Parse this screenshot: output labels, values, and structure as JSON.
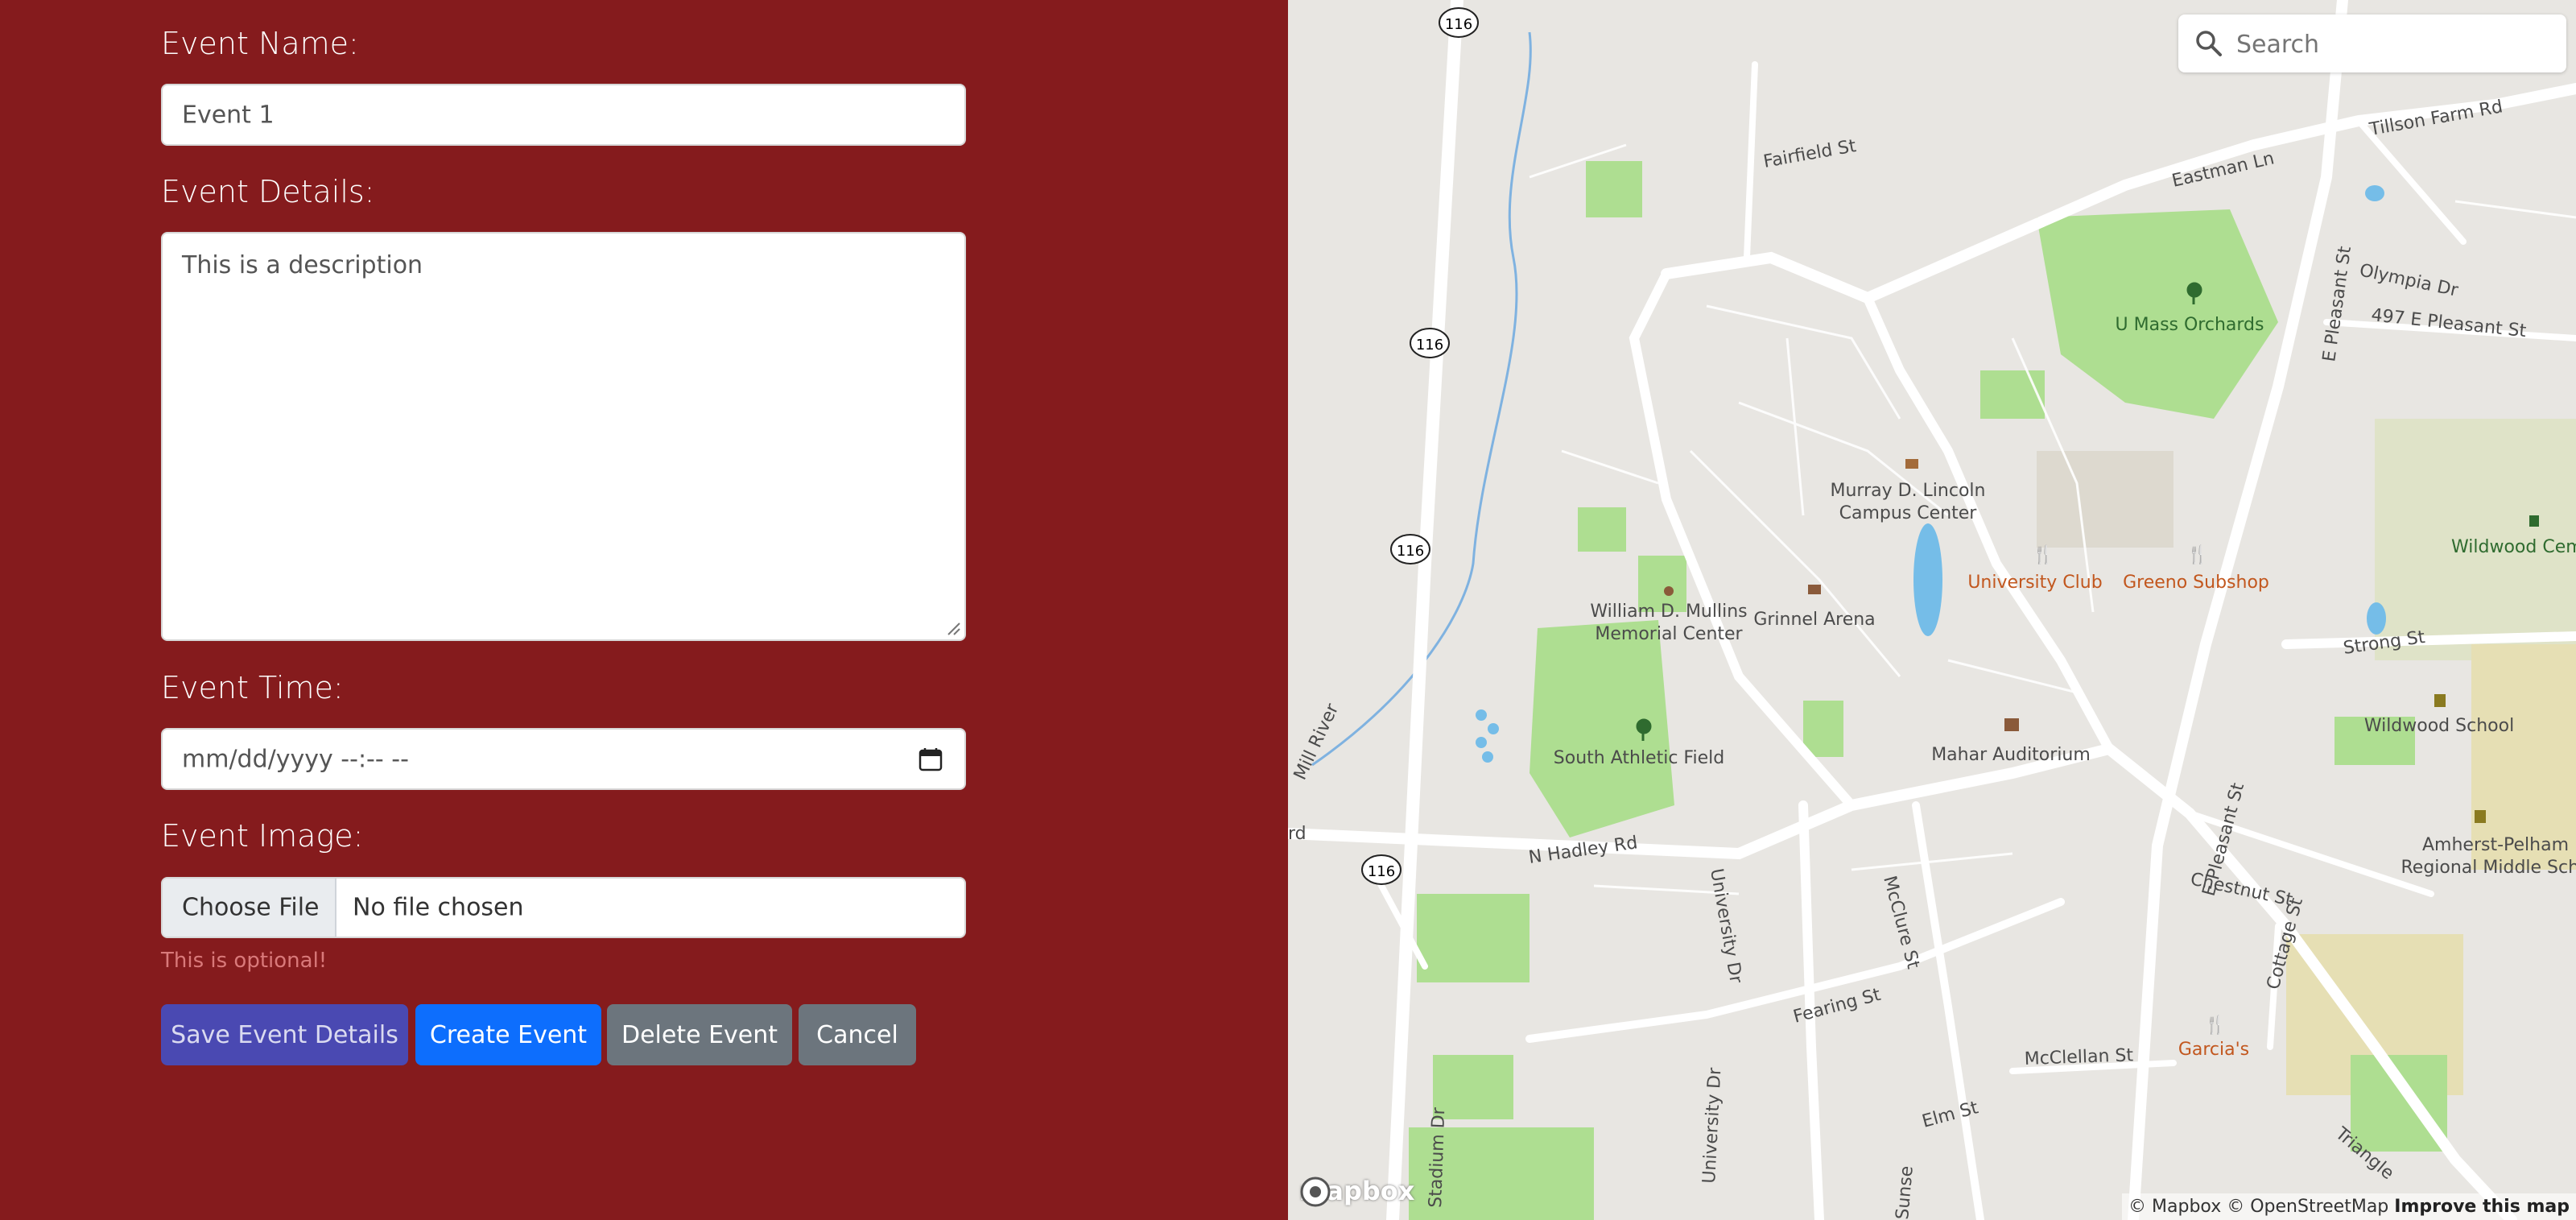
{
  "form": {
    "name_label": "Event Name:",
    "name_value": "Event 1",
    "details_label": "Event Details:",
    "details_value": "This is a description",
    "time_label": "Event Time:",
    "time_placeholder": "mm/dd/yyyy --:-- --",
    "image_label": "Event Image:",
    "choose_file_label": "Choose File",
    "file_status": "No file chosen",
    "optional_hint": "This is optional!",
    "buttons": {
      "save": "Save Event Details",
      "create": "Create Event",
      "delete": "Delete Event",
      "cancel": "Cancel"
    }
  },
  "map": {
    "search_placeholder": "Search",
    "logo_text": "mapbox",
    "attribution": {
      "mapbox": "© Mapbox",
      "osm": "© OpenStreetMap",
      "improve": "Improve this map"
    },
    "route_shields": [
      "116",
      "116",
      "116",
      "116"
    ],
    "labels": {
      "fairfield": "Fairfield St",
      "eastman": "Eastman Ln",
      "tillson": "Tillson Farm Rd",
      "olympia": "Olympia Dr",
      "e_pleasant_497": "497 E Pleasant St",
      "e_pleasant": "E Pleasant St",
      "e_pleasant_2": "E Pleasant St",
      "orchards": "U Mass Orchards",
      "lincoln_1": "Murray D. Lincoln",
      "lincoln_2": "Campus Center",
      "univ_club": "University Club",
      "greeno": "Greeno Subshop",
      "wildwood_cem": "Wildwood Ceme",
      "strong": "Strong St",
      "mullins_1": "William D. Mullins",
      "mullins_2": "Memorial Center",
      "grinnel": "Grinnel Arena",
      "south_field": "South Athletic Field",
      "mahar": "Mahar Auditorium",
      "wildwood_school": "Wildwood School",
      "amherst_1": "Amherst-Pelham",
      "amherst_2": "Regional Middle Scho",
      "mill_river": "Mill River",
      "n_hadley": "N Hadley Rd",
      "university_dr": "University Dr",
      "university_dr_2": "University Dr",
      "mcclure": "McClure St",
      "chestnut": "Chestnut St",
      "cottage": "Cottage St",
      "fearing": "Fearing St",
      "mcclellan": "McClellan St",
      "garcias": "Garcia's",
      "elm": "Elm St",
      "triangle": "Triangle",
      "stadium": "Stadium Dr",
      "sunset": "Sunse",
      "rd": "rd"
    }
  }
}
